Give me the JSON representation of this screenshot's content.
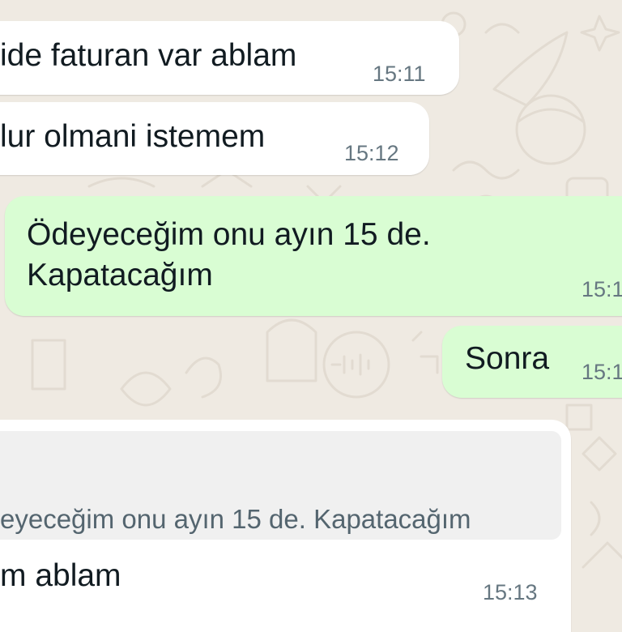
{
  "messages": [
    {
      "direction": "incoming",
      "text": "ide faturan var ablam",
      "time": "15:11"
    },
    {
      "direction": "incoming",
      "text": "lur olmani istemem",
      "time": "15:12"
    },
    {
      "direction": "outgoing",
      "lines": [
        "Ödeyeceğim onu ayın 15 de.",
        "Kapatacağım"
      ],
      "time": "15:1"
    },
    {
      "direction": "outgoing",
      "text": "Sonra",
      "time": "15:1"
    },
    {
      "direction": "incoming",
      "quoted_text": "eyeceğim onu ayın 15 de. Kapatacağım",
      "text": "m ablam",
      "time": "15:13"
    }
  ],
  "colors": {
    "background": "#efeae2",
    "incoming_bubble": "#ffffff",
    "outgoing_bubble": "#d9fdd3",
    "quote_background": "#f0f0f0",
    "text": "#111b21",
    "time": "#667781"
  }
}
